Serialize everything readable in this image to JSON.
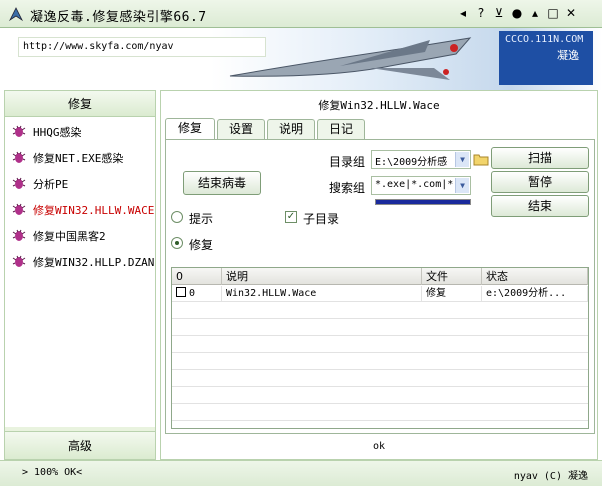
{
  "window": {
    "title": "凝逸反毒.修复感染引擎66.7",
    "controls": [
      "◂",
      "?",
      "⊻",
      "●",
      "▴",
      "□",
      "✕"
    ]
  },
  "banner": {
    "url": "http://www.skyfa.com/nyav",
    "brand_line1": "CCCO.111N.COM",
    "brand_line2": "凝逸"
  },
  "sidebar": {
    "header": "修复",
    "items": [
      {
        "label": "HHQG感染"
      },
      {
        "label": "修复NET.EXE感染"
      },
      {
        "label": "分析PE"
      },
      {
        "label": "修复WIN32.HLLW.WACE"
      },
      {
        "label": "修复中国黑客2"
      },
      {
        "label": "修复WIN32.HLLP.DZAN"
      }
    ],
    "footer": "高级"
  },
  "main": {
    "title": "修复Win32.HLLW.Wace",
    "tabs": [
      "修复",
      "设置",
      "说明",
      "日记"
    ],
    "end_virus_button": "结束病毒",
    "dir_group_label": "目录组",
    "dir_group_value": "E:\\2009分析感",
    "search_group_label": "搜索组",
    "search_group_value": "*.exe|*.com|*",
    "scan_button": "扫描",
    "pause_button": "暂停",
    "end_button": "结束",
    "radio_prompt": "提示",
    "radio_repair": "修复",
    "subdir_checkbox": "子目录",
    "columns": [
      "0",
      "说明",
      "文件",
      "状态"
    ],
    "rows": [
      {
        "index": "0",
        "desc": "Win32.HLLW.Wace",
        "file": "修复",
        "status": "e:\\2009分析..."
      }
    ],
    "status_text": "ok"
  },
  "statusbar": {
    "left": "> 100% OK<",
    "right": "nyav (C) 凝逸"
  }
}
